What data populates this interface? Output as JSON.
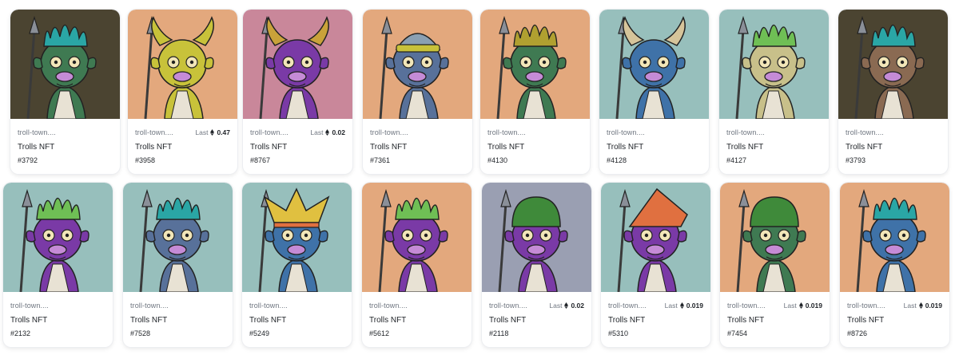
{
  "grid": {
    "rows": [
      [
        {
          "collection": "troll-town....",
          "name": "Trolls NFT",
          "token": "#3792",
          "last_label": "",
          "last_price": "",
          "bg": "#4b4431",
          "skin": "#3f7a52",
          "hair": "#2aa6a5",
          "hat": "none"
        },
        {
          "collection": "troll-town....",
          "name": "Trolls NFT",
          "token": "#3958",
          "last_label": "Last",
          "last_price": "0.47",
          "bg": "#e3a87d",
          "skin": "#c8c23a",
          "hair": "#c8c23a",
          "hat": "horns"
        },
        {
          "collection": "troll-town....",
          "name": "Trolls NFT",
          "token": "#8767",
          "last_label": "Last",
          "last_price": "0.02",
          "bg": "#c9879a",
          "skin": "#7a3aa6",
          "hair": "#c9a23a",
          "hat": "horns"
        },
        {
          "collection": "troll-town....",
          "name": "Trolls NFT",
          "token": "#7361",
          "last_label": "",
          "last_price": "",
          "bg": "#e3a87d",
          "skin": "#58719a",
          "hair": "#8aa0b3",
          "hat": "beanie"
        },
        {
          "collection": "troll-town....",
          "name": "Trolls NFT",
          "token": "#4130",
          "last_label": "",
          "last_price": "",
          "bg": "#e3a87d",
          "skin": "#3f7a52",
          "hair": "#b0a030",
          "hat": "none"
        },
        {
          "collection": "troll-town....",
          "name": "Trolls NFT",
          "token": "#4128",
          "last_label": "",
          "last_price": "",
          "bg": "#97bfbc",
          "skin": "#3f72a8",
          "hair": "#d6c49a",
          "hat": "horns"
        },
        {
          "collection": "troll-town....",
          "name": "Trolls NFT",
          "token": "#4127",
          "last_label": "",
          "last_price": "",
          "bg": "#97bfbc",
          "skin": "#c8c08a",
          "hair": "#6fbf55",
          "hat": "none"
        },
        {
          "collection": "troll-town....",
          "name": "Trolls NFT",
          "token": "#3793",
          "last_label": "",
          "last_price": "",
          "bg": "#4b4431",
          "skin": "#8a6a52",
          "hair": "#2aa6a5",
          "hat": "none"
        }
      ],
      [
        {
          "collection": "troll-town....",
          "name": "Trolls NFT",
          "token": "#2132",
          "last_label": "",
          "last_price": "",
          "bg": "#97bfbc",
          "skin": "#7a3aa6",
          "hair": "#6fbf55",
          "hat": "none"
        },
        {
          "collection": "troll-town....",
          "name": "Trolls NFT",
          "token": "#7528",
          "last_label": "",
          "last_price": "",
          "bg": "#97bfbc",
          "skin": "#58719a",
          "hair": "#2aa6a5",
          "hat": "none"
        },
        {
          "collection": "troll-town....",
          "name": "Trolls NFT",
          "token": "#5249",
          "last_label": "",
          "last_price": "",
          "bg": "#97bfbc",
          "skin": "#3f72a8",
          "hair": "#e0c040",
          "hat": "jester"
        },
        {
          "collection": "troll-town....",
          "name": "Trolls NFT",
          "token": "#5612",
          "last_label": "",
          "last_price": "",
          "bg": "#e3a87d",
          "skin": "#7a3aa6",
          "hair": "#6fbf55",
          "hat": "none"
        },
        {
          "collection": "troll-town....",
          "name": "Trolls NFT",
          "token": "#2118",
          "last_label": "Last",
          "last_price": "0.02",
          "bg": "#9a9fb2",
          "skin": "#7a3aa6",
          "hair": "#3f8a3a",
          "hat": "helmet"
        },
        {
          "collection": "troll-town....",
          "name": "Trolls NFT",
          "token": "#5310",
          "last_label": "Last",
          "last_price": "0.019",
          "bg": "#97bfbc",
          "skin": "#7a3aa6",
          "hair": "#e07040",
          "hat": "wizard"
        },
        {
          "collection": "troll-town....",
          "name": "Trolls NFT",
          "token": "#7454",
          "last_label": "Last",
          "last_price": "0.019",
          "bg": "#e3a87d",
          "skin": "#3f7a52",
          "hair": "#3f8a3a",
          "hat": "helmet"
        },
        {
          "collection": "troll-town....",
          "name": "Trolls NFT",
          "token": "#8726",
          "last_label": "Last",
          "last_price": "0.019",
          "bg": "#e3a87d",
          "skin": "#3f72a8",
          "hair": "#2aa6a5",
          "hat": "none"
        }
      ]
    ]
  }
}
